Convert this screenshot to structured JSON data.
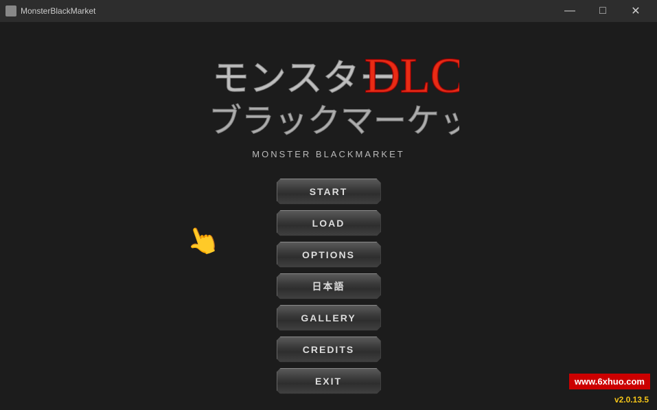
{
  "titlebar": {
    "title": "MonsterBlackMarket",
    "minimize_label": "—",
    "maximize_label": "□",
    "close_label": "✕"
  },
  "logo": {
    "subtitle": "MONSTER BLACKMARKET"
  },
  "menu": {
    "start_label": "START",
    "load_label": "LOAD",
    "options_label": "OPTIONS",
    "language_label": "日本語",
    "gallery_label": "GALLERY",
    "credits_label": "CREDITS",
    "exit_label": "EXIT"
  },
  "watermark": {
    "text": "www.6xhuo.com"
  },
  "version": {
    "text": "v2.0.13.5"
  }
}
